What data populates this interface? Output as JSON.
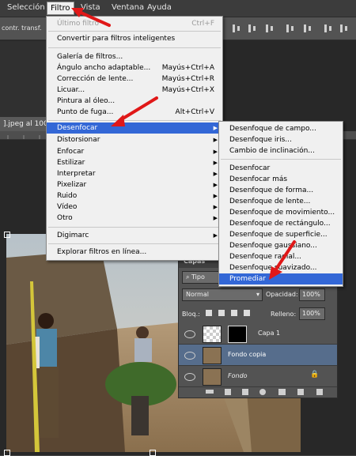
{
  "menubar": {
    "items": [
      "Selección",
      "Filtro",
      "Vista",
      "Ventana",
      "Ayuda"
    ]
  },
  "options_bar": {
    "left_text": "contr. transf."
  },
  "document": {
    "tab_title": "].jpeg al 100"
  },
  "filter_menu": {
    "last_filter": {
      "label": "Último filtro",
      "shortcut": "Ctrl+F"
    },
    "convert_smart": "Convertir para filtros inteligentes",
    "items_a": [
      {
        "label": "Galería de filtros...",
        "shortcut": ""
      },
      {
        "label": "Ángulo ancho adaptable...",
        "shortcut": "Mayús+Ctrl+A"
      },
      {
        "label": "Corrección de lente...",
        "shortcut": "Mayús+Ctrl+R"
      },
      {
        "label": "Licuar...",
        "shortcut": "Mayús+Ctrl+X"
      },
      {
        "label": "Pintura al óleo...",
        "shortcut": ""
      },
      {
        "label": "Punto de fuga...",
        "shortcut": "Alt+Ctrl+V"
      }
    ],
    "submenus": [
      "Desenfocar",
      "Distorsionar",
      "Enfocar",
      "Estilizar",
      "Interpretar",
      "Pixelizar",
      "Ruido",
      "Vídeo",
      "Otro"
    ],
    "digimarc": "Digimarc",
    "browse": "Explorar filtros en línea..."
  },
  "blur_submenu": {
    "group1": [
      "Desenfoque de campo...",
      "Desenfoque iris...",
      "Cambio de inclinación..."
    ],
    "group2": [
      "Desenfocar",
      "Desenfocar más",
      "Desenfoque de forma...",
      "Desenfoque de lente...",
      "Desenfoque de movimiento...",
      "Desenfoque de rectángulo...",
      "Desenfoque de superficie...",
      "Desenfoque gaussiano...",
      "Desenfoque radial...",
      "Desenfoque suavizado...",
      "Promediar"
    ]
  },
  "layers_panel": {
    "tab": "Capas",
    "kind": "Tipo",
    "blend_mode": "Normal",
    "opacity_label": "Opacidad:",
    "opacity_value": "100%",
    "lock_label": "Bloq.:",
    "fill_label": "Relleno:",
    "fill_value": "100%",
    "layers": [
      "Capa 1",
      "Fondo copia",
      "Fondo"
    ]
  },
  "colors": {
    "highlight": "#3367d6",
    "arrow": "#e01818"
  }
}
